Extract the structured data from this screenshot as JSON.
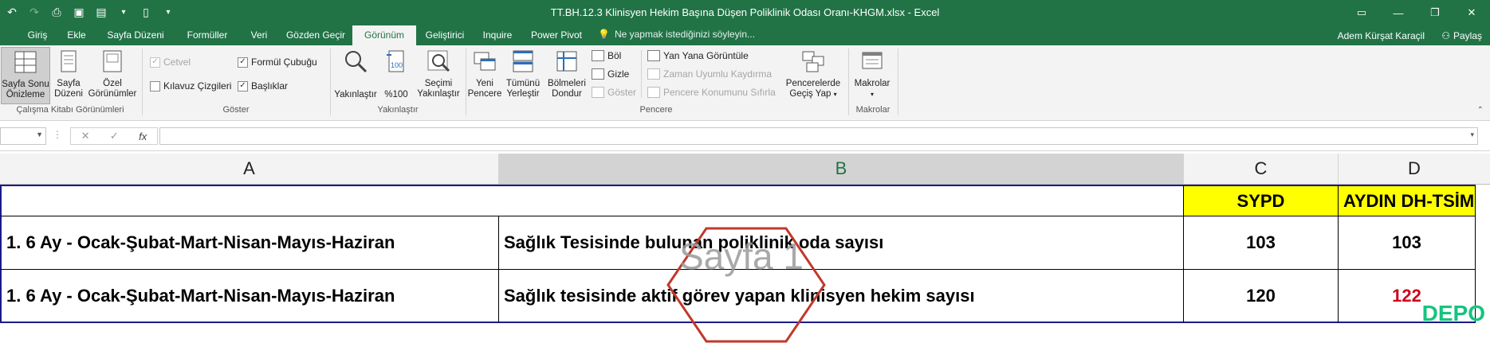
{
  "window": {
    "title": "TT.BH.12.3 Klinisyen Hekim Başına Düşen Poliklinik Odası Oranı-KHGM.xlsx - Excel",
    "controls": [
      "restore-ribbon",
      "minimize",
      "restore",
      "close"
    ]
  },
  "tabs": [
    {
      "label": "Giriş"
    },
    {
      "label": "Ekle"
    },
    {
      "label": "Sayfa Düzeni"
    },
    {
      "label": "Formüller"
    },
    {
      "label": "Veri"
    },
    {
      "label": "Gözden Geçir"
    },
    {
      "label": "Görünüm",
      "active": true
    },
    {
      "label": "Geliştirici"
    },
    {
      "label": "Inquire"
    },
    {
      "label": "Power Pivot"
    }
  ],
  "tell_me": "Ne yapmak istediğinizi söyleyin...",
  "user_name": "Adem Kürşat Karaçil",
  "share_label": "Paylaş",
  "ribbon": {
    "workbook_views": {
      "label": "Çalışma Kitabı Görünümleri",
      "page_break_preview": [
        "Sayfa Sonu",
        "Önizleme"
      ],
      "page_layout": [
        "Sayfa",
        "Düzeni"
      ],
      "custom_views": [
        "Özel",
        "Görünümler"
      ]
    },
    "show": {
      "label": "Göster",
      "ruler": "Cetvel",
      "gridlines": "Kılavuz Çizgileri",
      "formula_bar": "Formül Çubuğu",
      "headings": "Başlıklar"
    },
    "zoom": {
      "label": "Yakınlaştır",
      "zoom_btn": "Yakınlaştır",
      "zoom100": "%100",
      "zoom_selection": [
        "Seçimi",
        "Yakınlaştır"
      ]
    },
    "window": {
      "label": "Pencere",
      "new_window": [
        "Yeni",
        "Pencere"
      ],
      "arrange_all": [
        "Tümünü",
        "Yerleştir"
      ],
      "freeze_panes": [
        "Bölmeleri",
        "Dondur"
      ],
      "split": "Böl",
      "hide": "Gizle",
      "unhide": "Göster",
      "view_side_by_side": "Yan Yana Görüntüle",
      "sync_scroll": "Zaman Uyumlu Kaydırma",
      "reset_position": "Pencere Konumunu Sıfırla",
      "switch_windows": [
        "Pencerelerde",
        "Geçiş Yap"
      ]
    },
    "macros": {
      "label": "Makrolar",
      "macros_btn": "Makrolar"
    }
  },
  "formula_bar": {
    "name_box": "",
    "formula": "",
    "fx": "fx"
  },
  "sheet": {
    "columns": [
      "A",
      "B",
      "C",
      "D"
    ],
    "rows": [
      {
        "a": "",
        "b": "",
        "c": "SYPD",
        "d": "AYDIN DH-TSİM"
      },
      {
        "a": "1. 6 Ay - Ocak-Şubat-Mart-Nisan-Mayıs-Haziran",
        "b": "Sağlık Tesisinde bulunan poliklinik oda sayısı",
        "c": "103",
        "d": "103"
      },
      {
        "a": "1. 6 Ay - Ocak-Şubat-Mart-Nisan-Mayıs-Haziran",
        "b": "Sağlık tesisinde aktif görev yapan klinisyen hekim sayısı",
        "c": "120",
        "d": "122"
      }
    ],
    "page_watermark": "Sayfa 1"
  },
  "colors": {
    "excel_green": "#217346",
    "highlight_yellow": "#ffff00",
    "red_value": "#d0021b"
  },
  "logo": "DEPO"
}
